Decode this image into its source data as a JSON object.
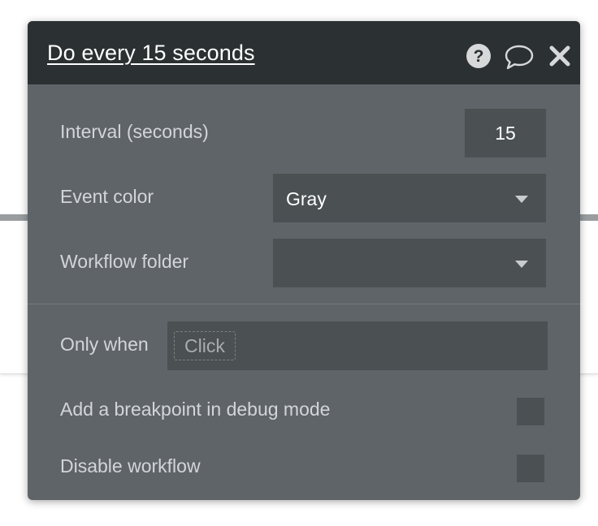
{
  "panel": {
    "title": "Do every 15 seconds",
    "icons": [
      "help-icon",
      "comment-icon",
      "close-icon"
    ]
  },
  "fields": {
    "interval": {
      "label": "Interval (seconds)",
      "value": "15"
    },
    "event_color": {
      "label": "Event color",
      "value": "Gray"
    },
    "workflow_folder": {
      "label": "Workflow folder",
      "value": ""
    },
    "only_when": {
      "label": "Only when",
      "placeholder": "Click"
    },
    "breakpoint": {
      "label": "Add a breakpoint in debug mode",
      "checked": false
    },
    "disable": {
      "label": "Disable workflow",
      "checked": false
    }
  },
  "colors": {
    "header_bg": "#2b3032",
    "panel_bg": "#5f6468",
    "input_bg": "#4b5053"
  }
}
